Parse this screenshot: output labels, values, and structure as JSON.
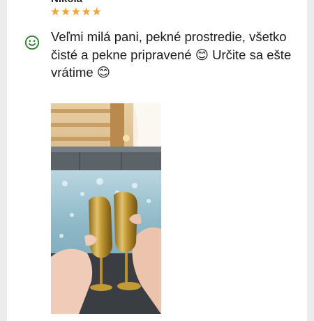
{
  "review": {
    "reviewer_name": "Nikola",
    "rating_stars": 5,
    "stars_text": "★★★★★",
    "sentiment_icon": "smiley-face-icon",
    "text": "Veľmi milá pani, pekné prostredie, všetko čisté a pekne pripravené 😊 Určite sa ešte vrátime 😊",
    "photo": "hot-tub-champagne-toast-photo"
  },
  "colors": {
    "star": "#f2a33a",
    "sentiment": "#2e7d32",
    "text": "#1a1a1a"
  }
}
